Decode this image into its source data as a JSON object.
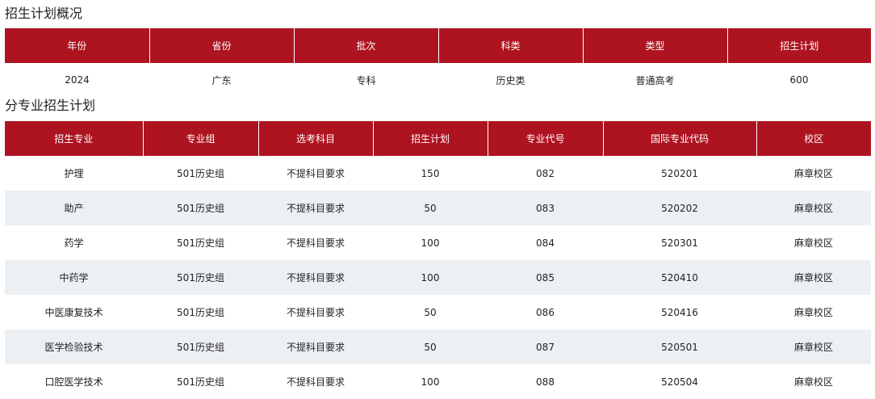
{
  "overview": {
    "title": "招生计划概况",
    "headers": [
      "年份",
      "省份",
      "批次",
      "科类",
      "类型",
      "招生计划"
    ],
    "row": [
      "2024",
      "广东",
      "专科",
      "历史类",
      "普通高考",
      "600"
    ]
  },
  "majors": {
    "title": "分专业招生计划",
    "headers": [
      "招生专业",
      "专业组",
      "选考科目",
      "招生计划",
      "专业代号",
      "国际专业代码",
      "校区"
    ],
    "rows": [
      [
        "护理",
        "501历史组",
        "不提科目要求",
        "150",
        "082",
        "520201",
        "麻章校区"
      ],
      [
        "助产",
        "501历史组",
        "不提科目要求",
        "50",
        "083",
        "520202",
        "麻章校区"
      ],
      [
        "药学",
        "501历史组",
        "不提科目要求",
        "100",
        "084",
        "520301",
        "麻章校区"
      ],
      [
        "中药学",
        "501历史组",
        "不提科目要求",
        "100",
        "085",
        "520410",
        "麻章校区"
      ],
      [
        "中医康复技术",
        "501历史组",
        "不提科目要求",
        "50",
        "086",
        "520416",
        "麻章校区"
      ],
      [
        "医学检验技术",
        "501历史组",
        "不提科目要求",
        "50",
        "087",
        "520501",
        "麻章校区"
      ],
      [
        "口腔医学技术",
        "501历史组",
        "不提科目要求",
        "100",
        "088",
        "520504",
        "麻章校区"
      ]
    ]
  },
  "colors": {
    "header_bg": "#ae1320",
    "header_text": "#ffffff",
    "alt_row": "#edf0f3"
  }
}
